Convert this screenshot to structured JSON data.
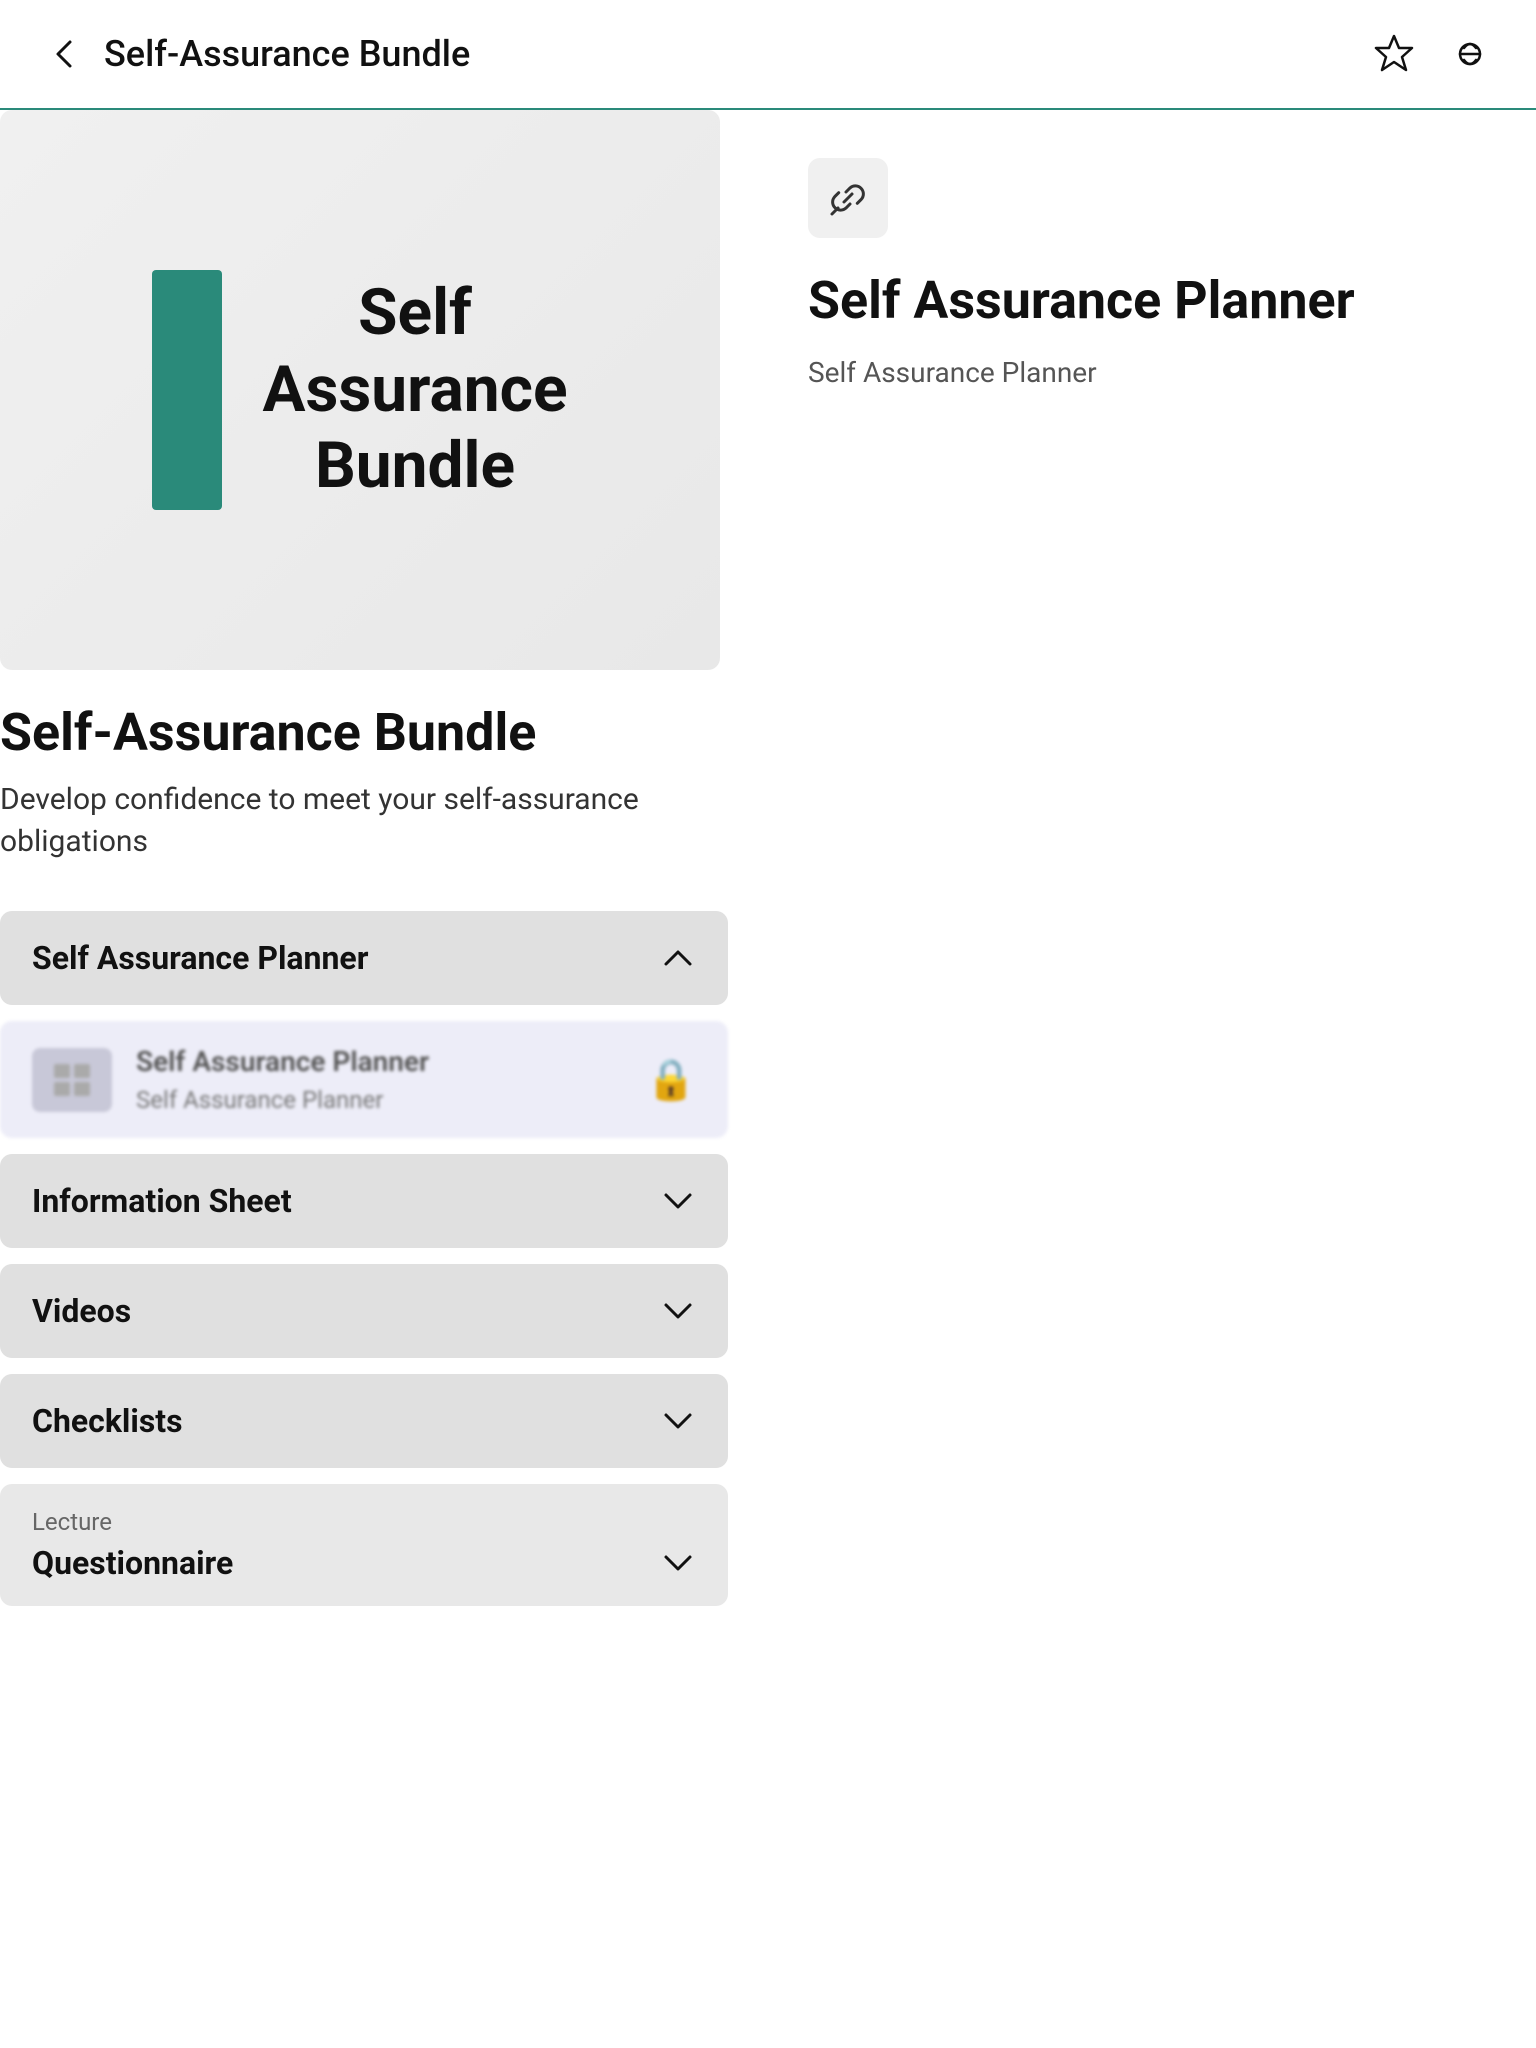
{
  "header": {
    "title": "Self-Assurance Bundle",
    "back_label": "Back"
  },
  "hero": {
    "bundle_name": "Self\nAssurance\nBundle"
  },
  "left": {
    "bundle_title": "Self-Assurance Bundle",
    "bundle_desc": "Develop confidence to meet your self-assurance obligations"
  },
  "accordion": {
    "items": [
      {
        "label": "Self Assurance Planner",
        "expanded": true
      },
      {
        "label": "Information Sheet",
        "expanded": false
      },
      {
        "label": "Videos",
        "expanded": false
      },
      {
        "label": "Checklists",
        "expanded": false
      }
    ],
    "locked_item": {
      "title": "Self Assurance Planner",
      "sub": "Self Assurance Planner"
    },
    "lecture": {
      "label": "Lecture",
      "title": "Questionnaire"
    }
  },
  "right": {
    "link_icon": "🔗",
    "title": "Self Assurance Planner",
    "sub": "Self Assurance Planner"
  },
  "icons": {
    "back": "‹",
    "star": "☆",
    "share": "⬡",
    "chevron_up": "∧",
    "chevron_down": "∨",
    "lock": "🔒",
    "link": "🔗"
  }
}
